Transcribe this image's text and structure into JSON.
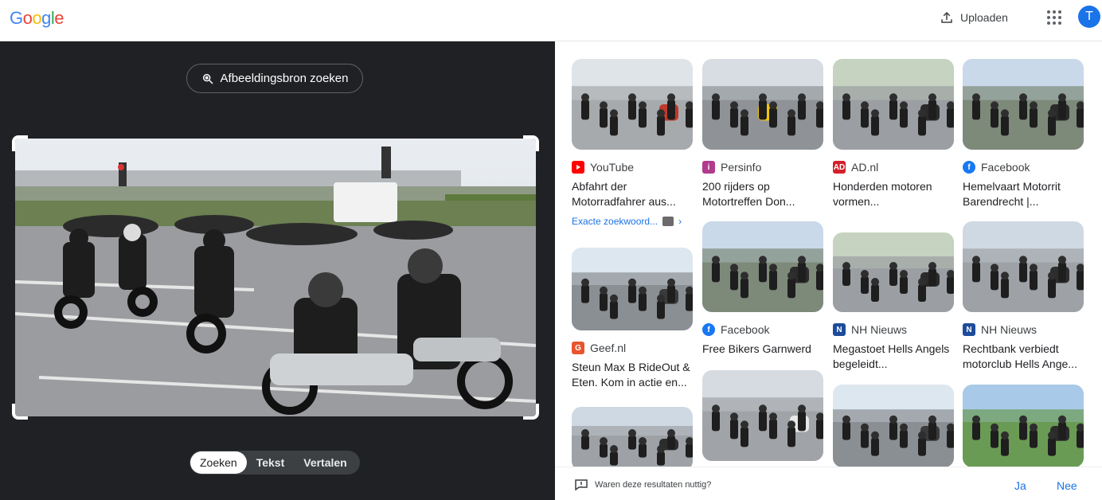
{
  "header": {
    "logo_letters": [
      {
        "ch": "G",
        "color": "#4285F4"
      },
      {
        "ch": "o",
        "color": "#EA4335"
      },
      {
        "ch": "o",
        "color": "#FBBC05"
      },
      {
        "ch": "g",
        "color": "#4285F4"
      },
      {
        "ch": "l",
        "color": "#34A853"
      },
      {
        "ch": "e",
        "color": "#EA4335"
      }
    ],
    "upload_label": "Uploaden",
    "avatar_initial": "T"
  },
  "lens": {
    "source_button_label": "Afbeeldingsbron zoeken",
    "modes": [
      "Zoeken",
      "Tekst",
      "Vertalen"
    ],
    "active_mode": "Zoeken"
  },
  "results": [
    {
      "source": "YouTube",
      "source_color": "#FF0000",
      "favicon": "play-icon",
      "title": "Abfahrt der Motorradfahrer aus...",
      "extra": "Exacte zoekwoord...",
      "theme": "street-red"
    },
    {
      "source": "Geef.nl",
      "source_color": "#E8542D",
      "favicon": "G",
      "title": "Steun Max B RideOut & Eten. Kom in actie en...",
      "theme": "crowd"
    },
    {
      "source": "",
      "theme": "street"
    },
    {
      "source": "Persinfo",
      "source_color": "#B03A8C",
      "favicon": "i",
      "title": "200 rijders op Motortreffen Don...",
      "theme": "yellow-bike"
    },
    {
      "source": "Facebook",
      "source_color": "#1877F2",
      "favicon": "f",
      "title": "Free Bikers Garnwerd",
      "theme": "group"
    },
    {
      "source": "",
      "theme": "police"
    },
    {
      "source": "AD.nl",
      "source_color": "#D3202A",
      "favicon": "AD",
      "title": "Honderden motoren vormen...",
      "theme": "road"
    },
    {
      "source": "NH Nieuws",
      "source_color": "#1E4B9C",
      "favicon": "N",
      "title": "Megastoet Hells Angels begeleidt...",
      "theme": "road"
    },
    {
      "source": "",
      "theme": "crowd"
    },
    {
      "source": "Facebook",
      "source_color": "#1877F2",
      "favicon": "f",
      "title": "Hemelvaart Motorrit Barendrecht |...",
      "theme": "group"
    },
    {
      "source": "NH Nieuws",
      "source_color": "#1E4B9C",
      "favicon": "N",
      "title": "Rechtbank verbiedt motorclub Hells Ange...",
      "theme": "street"
    },
    {
      "source": "",
      "theme": "trees"
    }
  ],
  "feedback": {
    "question": "Waren deze resultaten nuttig?",
    "yes": "Ja",
    "no": "Nee"
  }
}
